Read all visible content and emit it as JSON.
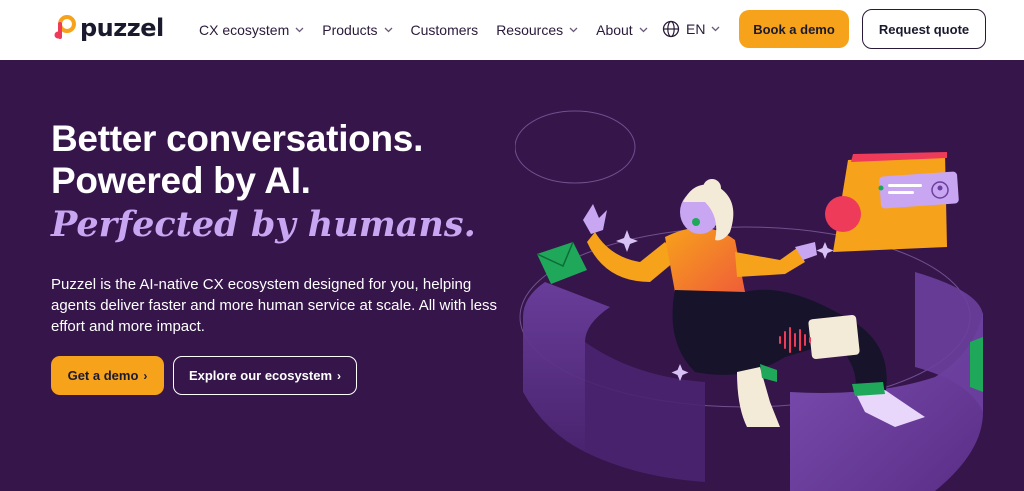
{
  "brand": {
    "name": "puzzel"
  },
  "nav": {
    "items": [
      {
        "label": "CX ecosystem",
        "has_dropdown": true
      },
      {
        "label": "Products",
        "has_dropdown": true
      },
      {
        "label": "Customers",
        "has_dropdown": false
      },
      {
        "label": "Resources",
        "has_dropdown": true
      },
      {
        "label": "About",
        "has_dropdown": true
      }
    ],
    "language": "EN",
    "book_demo": "Book a demo",
    "request_quote": "Request quote"
  },
  "hero": {
    "headline_1": "Better conversations.",
    "headline_2": "Powered by AI.",
    "headline_3": "Perfected by humans.",
    "description": "Puzzel is the AI-native CX ecosystem designed for you, helping agents deliver faster and more human service at scale. All with less effort and more impact.",
    "cta_primary": "Get a demo",
    "cta_secondary": "Explore our ecosystem"
  },
  "colors": {
    "background": "#35154a",
    "accent": "#f7a21b",
    "headline_italic": "#c9a6f2"
  }
}
